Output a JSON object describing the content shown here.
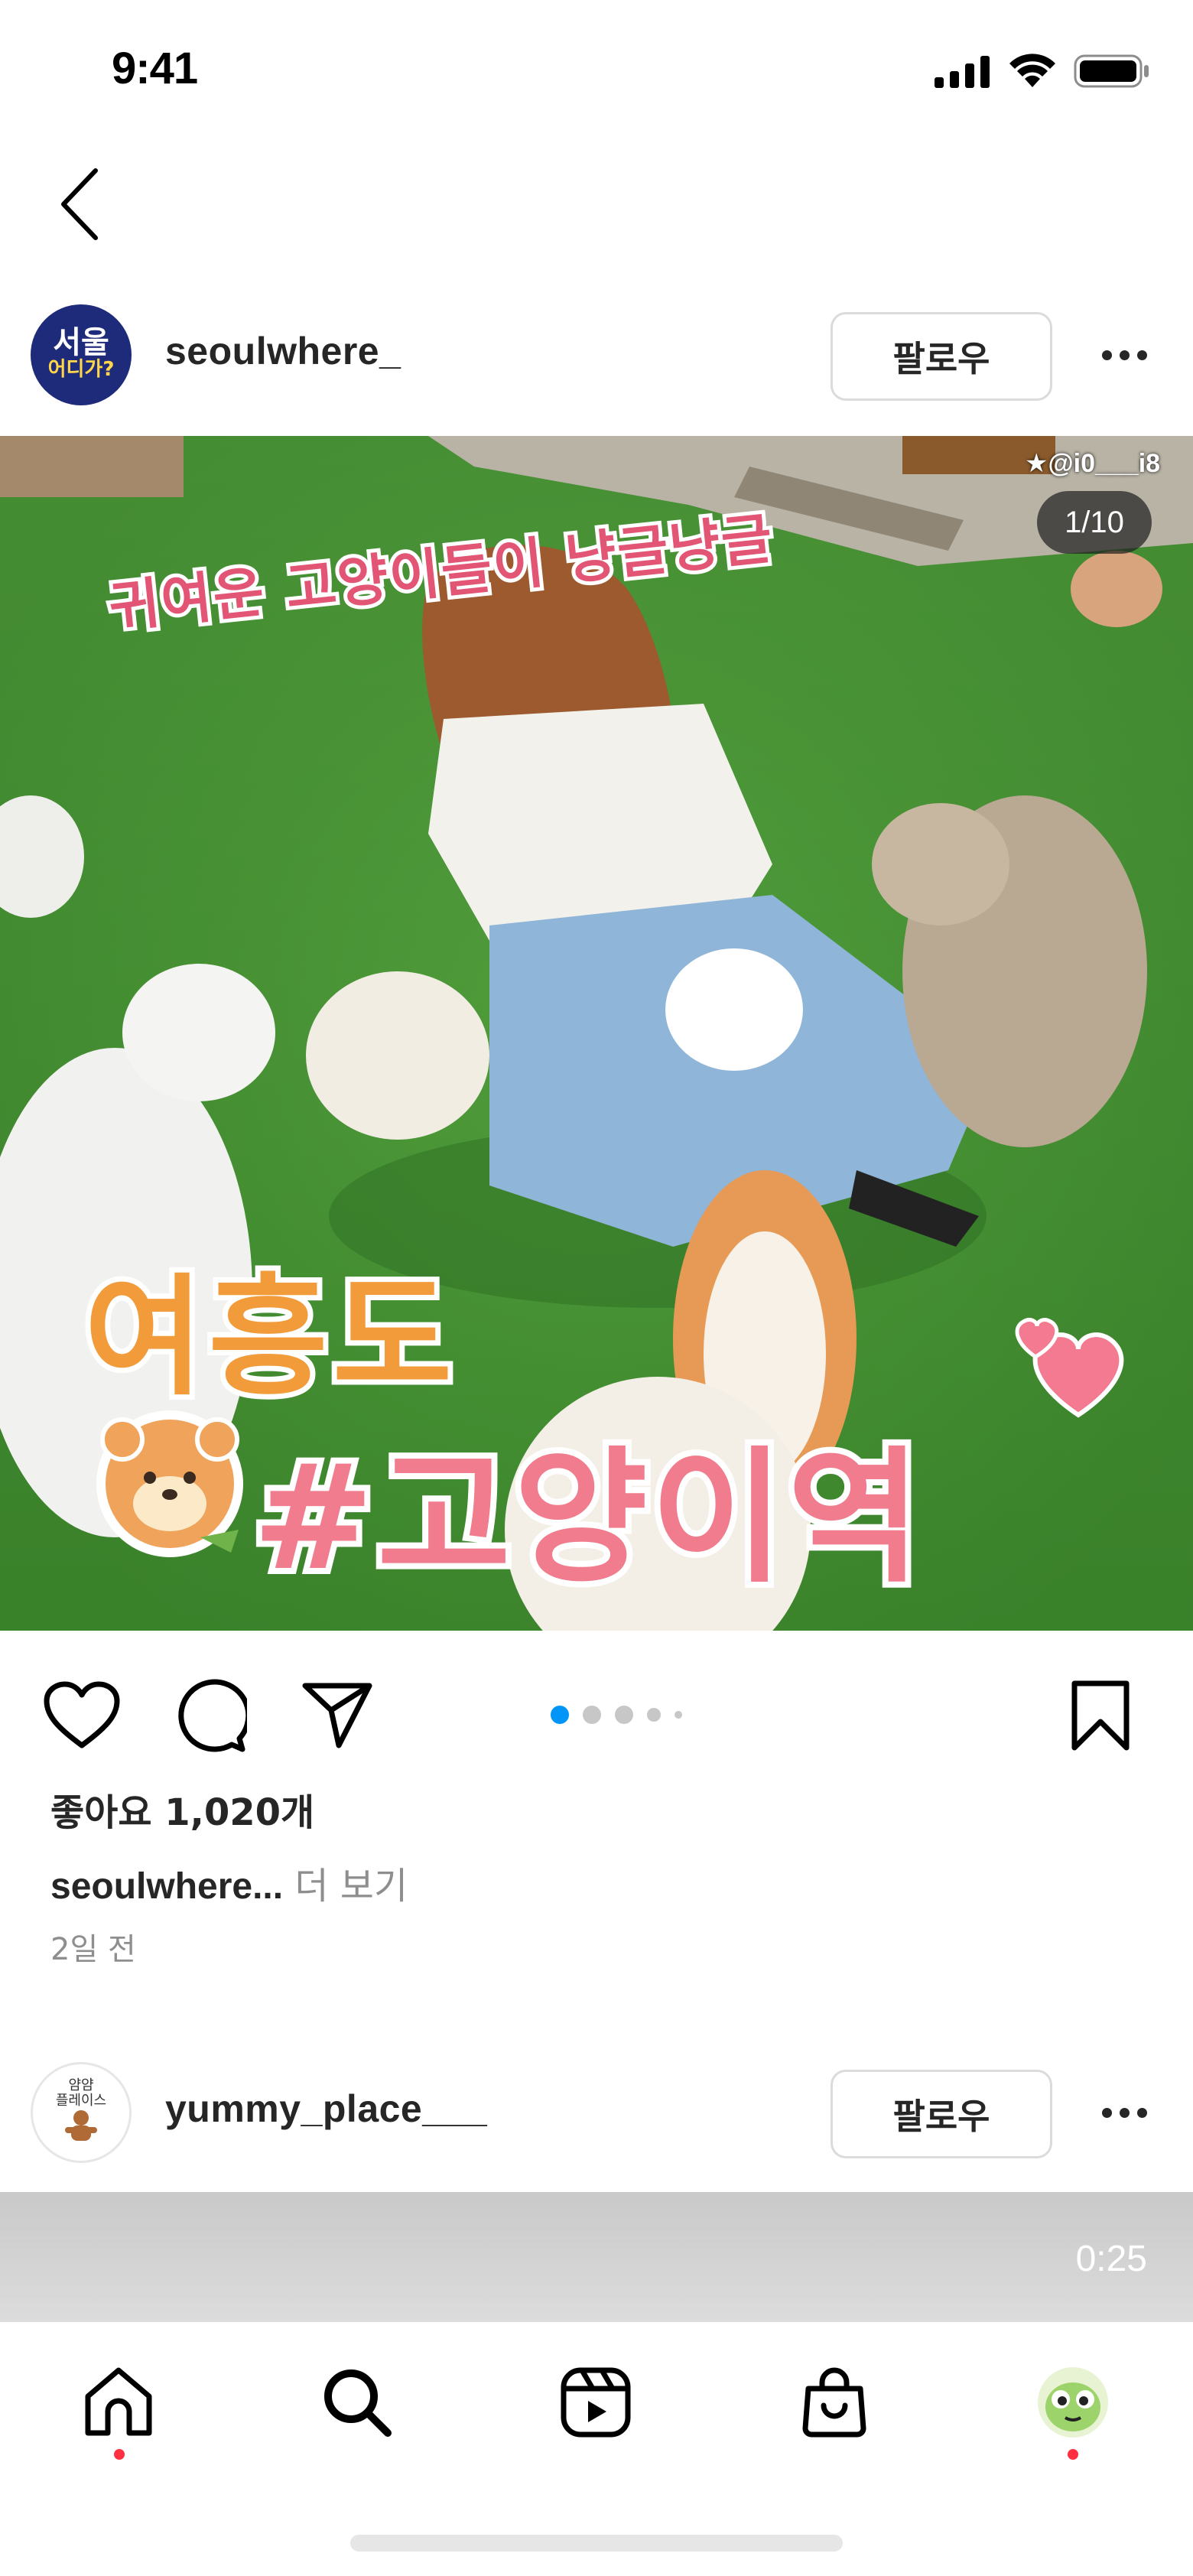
{
  "status_bar": {
    "time": "9:41"
  },
  "posts": [
    {
      "username": "seoulwhere_",
      "avatar_text_line1": "서울",
      "avatar_text_line2": "어디가?",
      "follow_label": "팔로우",
      "image_counter": "1/10",
      "image_credit": "★@i0___i8",
      "overlay_top": "귀여운 고양이들이 냥글냥글",
      "overlay_title_1": "여흥도",
      "overlay_title_2": "#고양이역",
      "likes": "좋아요 1,020개",
      "caption_user": "seoulwhere...",
      "caption_more": " 더 보기",
      "time_ago": "2일 전"
    },
    {
      "username": "yummy_place___",
      "avatar_text_line1": "얌얌",
      "avatar_text_line2": "플레이스",
      "follow_label": "팔로우",
      "video_duration": "0:25"
    }
  ],
  "carousel": {
    "active_index": 0,
    "count": 5
  },
  "icons": {
    "back": "chevron-left-icon",
    "like": "heart-icon",
    "comment": "comment-icon",
    "share": "send-icon",
    "save": "bookmark-icon",
    "home": "home-icon",
    "search": "search-icon",
    "reels": "reels-icon",
    "shop": "shop-icon",
    "profile": "profile-avatar"
  },
  "colors": {
    "accent": "#0095f6",
    "notification": "#ff3040",
    "muted": "#8e8e8e"
  }
}
